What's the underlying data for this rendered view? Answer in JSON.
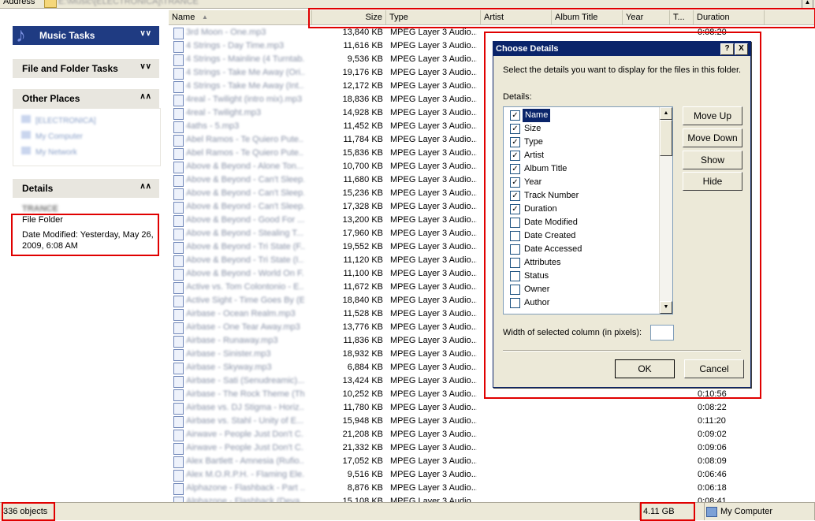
{
  "address": {
    "label": "Address",
    "path": "E:\\Music\\[ELECTRONICA]\\TRANCE"
  },
  "taskpane": {
    "music_tasks": "Music Tasks",
    "file_folder_tasks": "File and Folder Tasks",
    "other_places": {
      "title": "Other Places",
      "items": [
        "[ELECTRONICA]",
        "My Computer",
        "My Network"
      ]
    },
    "details": {
      "title": "Details",
      "name": "TRANCE",
      "type": "File Folder",
      "modified": "Date Modified: Yesterday, May 26, 2009, 6:08 AM"
    }
  },
  "columns": {
    "name": "Name",
    "size": "Size",
    "type": "Type",
    "artist": "Artist",
    "album": "Album Title",
    "year": "Year",
    "track": "T...",
    "duration": "Duration"
  },
  "files": [
    {
      "name": "3rd Moon - One.mp3",
      "size": "13,840 KB",
      "type": "MPEG Layer 3 Audio...",
      "duration": "0:08:20"
    },
    {
      "name": "4 Strings - Day Time.mp3",
      "size": "11,616 KB",
      "type": "MPEG Layer 3 Audio...",
      "duration": ""
    },
    {
      "name": "4 Strings - Mainline (4 Turntab...",
      "size": "9,536 KB",
      "type": "MPEG Layer 3 Audio...",
      "duration": ""
    },
    {
      "name": "4 Strings - Take Me Away (Ori...",
      "size": "19,176 KB",
      "type": "MPEG Layer 3 Audio...",
      "duration": ""
    },
    {
      "name": "4 Strings - Take Me Away (Int...",
      "size": "12,172 KB",
      "type": "MPEG Layer 3 Audio...",
      "duration": ""
    },
    {
      "name": "4real - Twilight (intro mix).mp3",
      "size": "18,836 KB",
      "type": "MPEG Layer 3 Audio...",
      "duration": ""
    },
    {
      "name": "4real - Twilight.mp3",
      "size": "14,928 KB",
      "type": "MPEG Layer 3 Audio...",
      "duration": ""
    },
    {
      "name": "4aths - 5.mp3",
      "size": "11,452 KB",
      "type": "MPEG Layer 3 Audio...",
      "duration": ""
    },
    {
      "name": "Abel Ramos - Te Quiero Pute...",
      "size": "11,784 KB",
      "type": "MPEG Layer 3 Audio...",
      "duration": ""
    },
    {
      "name": "Abel Ramos - Te Quiero Pute...",
      "size": "15,836 KB",
      "type": "MPEG Layer 3 Audio...",
      "duration": ""
    },
    {
      "name": "Above & Beyond - Alone Ton...",
      "size": "10,700 KB",
      "type": "MPEG Layer 3 Audio...",
      "duration": ""
    },
    {
      "name": "Above & Beyond - Can't Sleep...",
      "size": "11,680 KB",
      "type": "MPEG Layer 3 Audio...",
      "duration": ""
    },
    {
      "name": "Above & Beyond - Can't Sleep...",
      "size": "15,236 KB",
      "type": "MPEG Layer 3 Audio...",
      "duration": ""
    },
    {
      "name": "Above & Beyond - Can't Sleep...",
      "size": "17,328 KB",
      "type": "MPEG Layer 3 Audio...",
      "duration": ""
    },
    {
      "name": "Above & Beyond - Good For ...",
      "size": "13,200 KB",
      "type": "MPEG Layer 3 Audio...",
      "duration": ""
    },
    {
      "name": "Above & Beyond - Stealing T...",
      "size": "17,960 KB",
      "type": "MPEG Layer 3 Audio...",
      "duration": ""
    },
    {
      "name": "Above & Beyond - Tri State (F...",
      "size": "19,552 KB",
      "type": "MPEG Layer 3 Audio...",
      "duration": ""
    },
    {
      "name": "Above & Beyond - Tri State (I...",
      "size": "11,120 KB",
      "type": "MPEG Layer 3 Audio...",
      "duration": ""
    },
    {
      "name": "Above & Beyond - World On F...",
      "size": "11,100 KB",
      "type": "MPEG Layer 3 Audio...",
      "duration": ""
    },
    {
      "name": "Active vs. Tom Colontonio - E...",
      "size": "11,672 KB",
      "type": "MPEG Layer 3 Audio...",
      "duration": ""
    },
    {
      "name": "Active Sight - Time Goes By (E...",
      "size": "18,840 KB",
      "type": "MPEG Layer 3 Audio...",
      "duration": ""
    },
    {
      "name": "Airbase - Ocean Realm.mp3",
      "size": "11,528 KB",
      "type": "MPEG Layer 3 Audio...",
      "duration": ""
    },
    {
      "name": "Airbase - One Tear Away.mp3",
      "size": "13,776 KB",
      "type": "MPEG Layer 3 Audio...",
      "duration": ""
    },
    {
      "name": "Airbase - Runaway.mp3",
      "size": "11,836 KB",
      "type": "MPEG Layer 3 Audio...",
      "duration": ""
    },
    {
      "name": "Airbase - Sinister.mp3",
      "size": "18,932 KB",
      "type": "MPEG Layer 3 Audio...",
      "duration": ""
    },
    {
      "name": "Airbase - Skyway.mp3",
      "size": "6,884 KB",
      "type": "MPEG Layer 3 Audio...",
      "duration": ""
    },
    {
      "name": "Airbase - Sati (Senudreamic)...",
      "size": "13,424 KB",
      "type": "MPEG Layer 3 Audio...",
      "duration": ""
    },
    {
      "name": "Airbase - The Rock Theme (Th...",
      "size": "10,252 KB",
      "type": "MPEG Layer 3 Audio...",
      "duration": "0:10:56"
    },
    {
      "name": "Airbase vs. DJ Stigma - Horiz...",
      "size": "11,780 KB",
      "type": "MPEG Layer 3 Audio...",
      "duration": "0:08:22"
    },
    {
      "name": "Airbase vs. Stahl - Unity of E...",
      "size": "15,948 KB",
      "type": "MPEG Layer 3 Audio...",
      "duration": "0:11:20"
    },
    {
      "name": "Airwave - People Just Don't C...",
      "size": "21,208 KB",
      "type": "MPEG Layer 3 Audio...",
      "duration": "0:09:02"
    },
    {
      "name": "Airwave - People Just Don't C...",
      "size": "21,332 KB",
      "type": "MPEG Layer 3 Audio...",
      "duration": "0:09:06"
    },
    {
      "name": "Alex Bartlett - Amnesia (Rufio...",
      "size": "17,052 KB",
      "type": "MPEG Layer 3 Audio...",
      "duration": "0:08:09"
    },
    {
      "name": "Alex M.O.R.P.H. - Flaming Ele...",
      "size": "9,516 KB",
      "type": "MPEG Layer 3 Audio...",
      "duration": "0:06:46"
    },
    {
      "name": "Alphazone - Flashback - Part ...",
      "size": "8,876 KB",
      "type": "MPEG Layer 3 Audio...",
      "duration": "0:06:18"
    },
    {
      "name": "Alphazone - Flashback (Deva...",
      "size": "15,108 KB",
      "type": "MPEG Layer 3 Audio...",
      "duration": "0:08:41"
    }
  ],
  "dialog": {
    "title": "Choose Details",
    "help": "?",
    "close": "X",
    "description": "Select the details you want to display for the files in this folder.",
    "details_label": "Details:",
    "items": [
      {
        "label": "Name",
        "checked": true,
        "selected": true
      },
      {
        "label": "Size",
        "checked": true
      },
      {
        "label": "Type",
        "checked": true
      },
      {
        "label": "Artist",
        "checked": true
      },
      {
        "label": "Album Title",
        "checked": true
      },
      {
        "label": "Year",
        "checked": true
      },
      {
        "label": "Track Number",
        "checked": true
      },
      {
        "label": "Duration",
        "checked": true
      },
      {
        "label": "Date Modified",
        "checked": false
      },
      {
        "label": "Date Created",
        "checked": false
      },
      {
        "label": "Date Accessed",
        "checked": false
      },
      {
        "label": "Attributes",
        "checked": false
      },
      {
        "label": "Status",
        "checked": false
      },
      {
        "label": "Owner",
        "checked": false
      },
      {
        "label": "Author",
        "checked": false
      }
    ],
    "move_up": "Move Up",
    "move_down": "Move Down",
    "show": "Show",
    "hide": "Hide",
    "width_label": "Width of selected column (in pixels):",
    "width_value": "",
    "ok": "OK",
    "cancel": "Cancel"
  },
  "status": {
    "count": "336 objects",
    "size": "4.11 GB",
    "location": "My Computer"
  },
  "colors": {
    "highlight": "#e00000",
    "titlebar": "#0a246a",
    "music_header": "#1f3b82"
  }
}
